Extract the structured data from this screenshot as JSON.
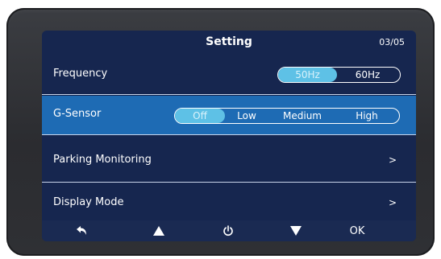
{
  "header": {
    "title": "Setting",
    "page_counter": "03/05"
  },
  "rows": [
    {
      "label": "Frequency",
      "options": [
        "50Hz",
        "60Hz"
      ],
      "selected_option": "50Hz"
    },
    {
      "label": "G-Sensor",
      "options": [
        "Off",
        "Low",
        "Medium",
        "High"
      ],
      "selected_option": "Off"
    },
    {
      "label": "Parking Monitoring",
      "chevron": ">"
    },
    {
      "label": "Display Mode",
      "chevron": ">"
    }
  ],
  "selected_row": "G-Sensor",
  "footer": {
    "buttons": [
      "back-icon",
      "up-arrow-icon",
      "power-icon",
      "down-arrow-icon",
      "OK"
    ],
    "ok_label": "OK"
  },
  "colors": {
    "screen_bg": "#16264f",
    "selected_row_bg": "#1e6bb4",
    "active_option_bg": "#5ec1e6",
    "footer_bg": "#1a2a52",
    "bezel": "#2f3034"
  }
}
